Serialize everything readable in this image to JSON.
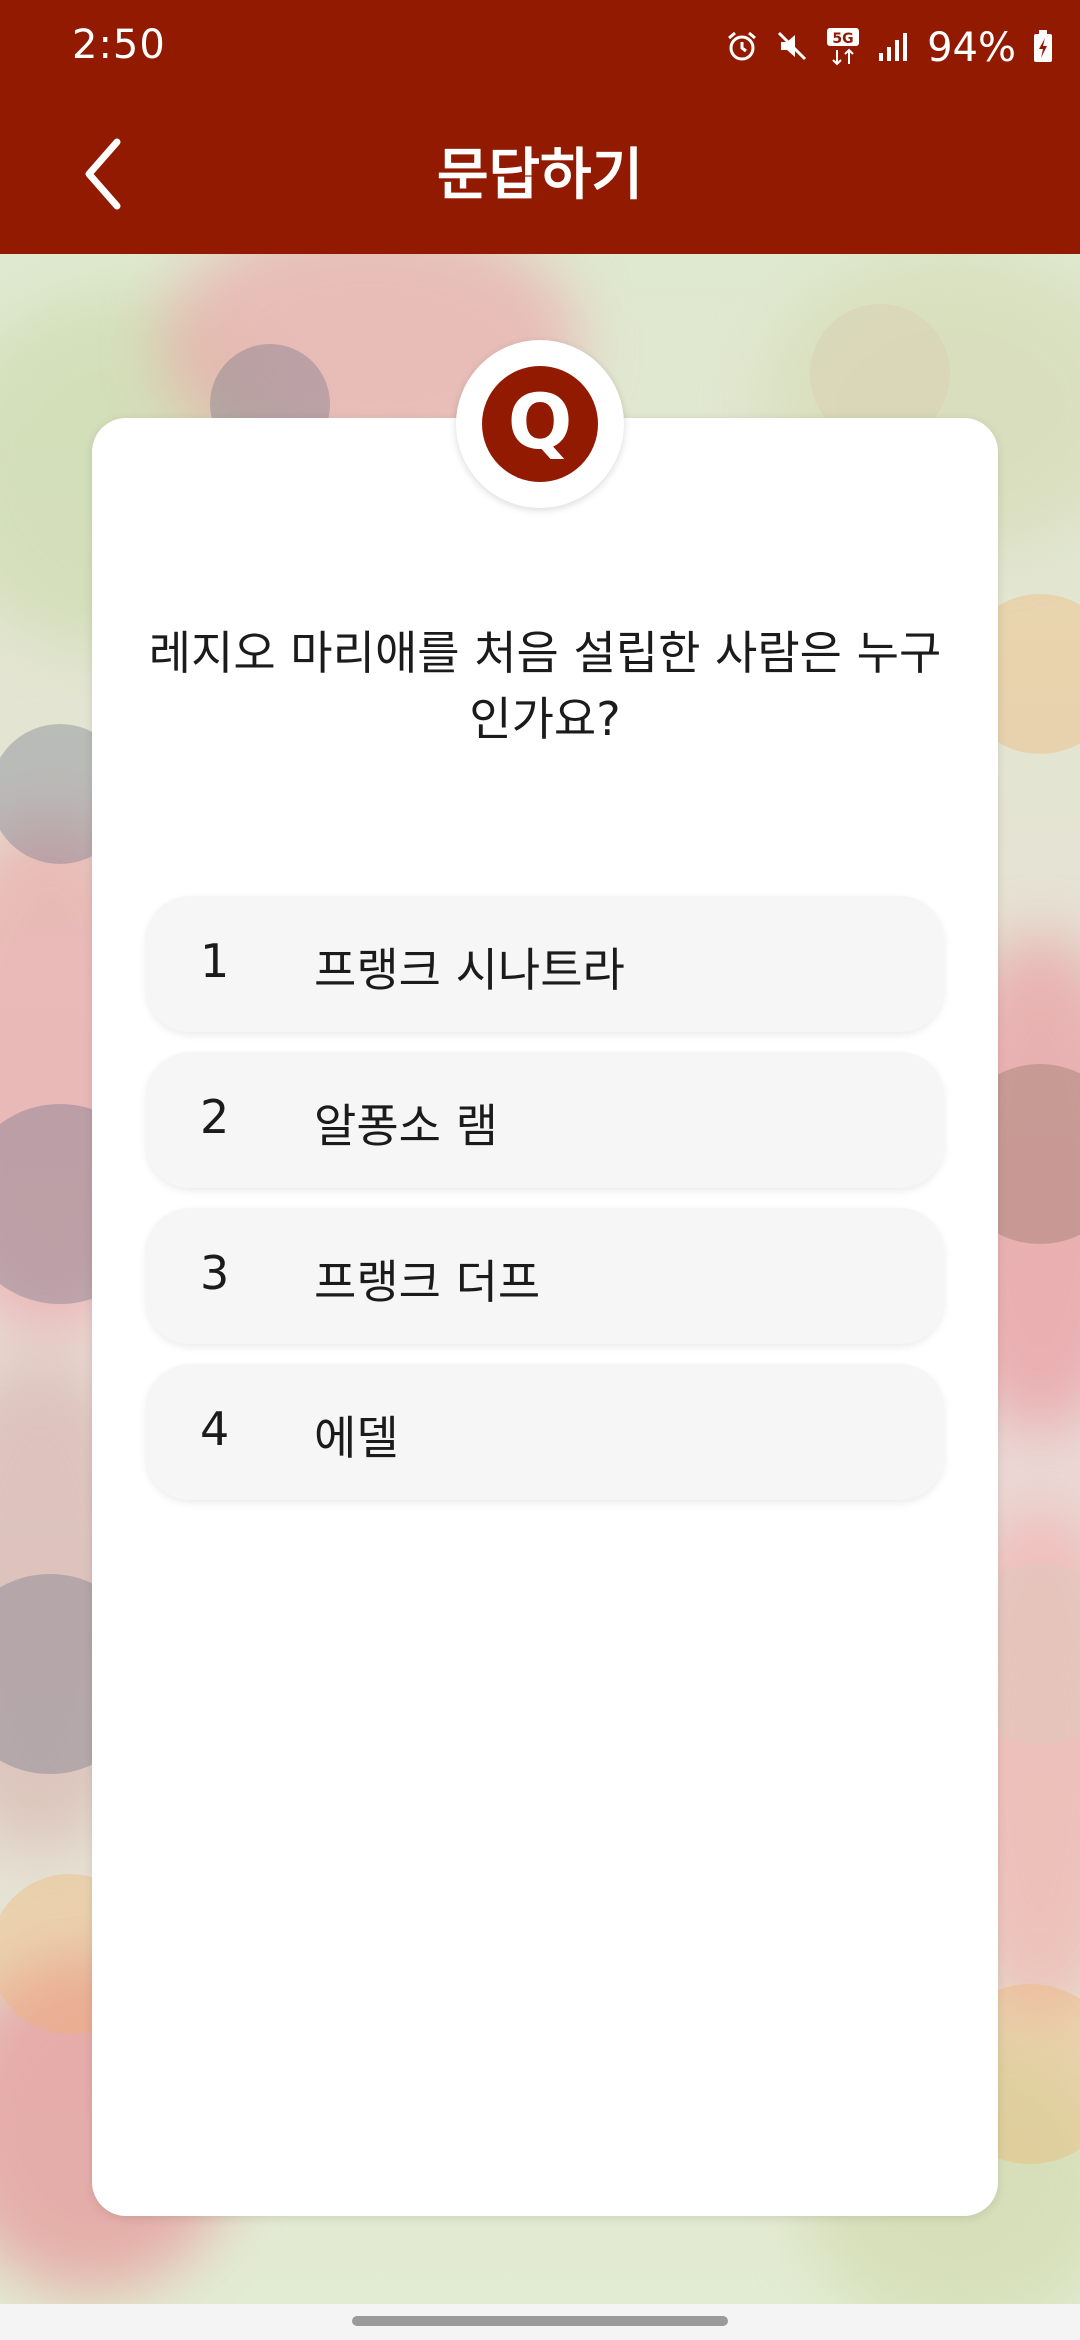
{
  "colors": {
    "accent": "#921a00",
    "white": "#ffffff"
  },
  "statusbar": {
    "time": "2:50",
    "battery": "94%",
    "icons": [
      "alarm-icon",
      "mute-icon",
      "5g-icon",
      "signal-icon",
      "battery-charging-icon"
    ]
  },
  "appbar": {
    "title": "문답하기",
    "back_icon": "chevron-left-icon"
  },
  "card": {
    "badge": "Q",
    "question": "레지오 마리애를 처음 설립한 사람은 누구인가요?",
    "answers": [
      {
        "num": "1",
        "text": "프랭크 시나트라"
      },
      {
        "num": "2",
        "text": "알퐁소 램"
      },
      {
        "num": "3",
        "text": "프랭크 더프"
      },
      {
        "num": "4",
        "text": "에델"
      }
    ]
  }
}
